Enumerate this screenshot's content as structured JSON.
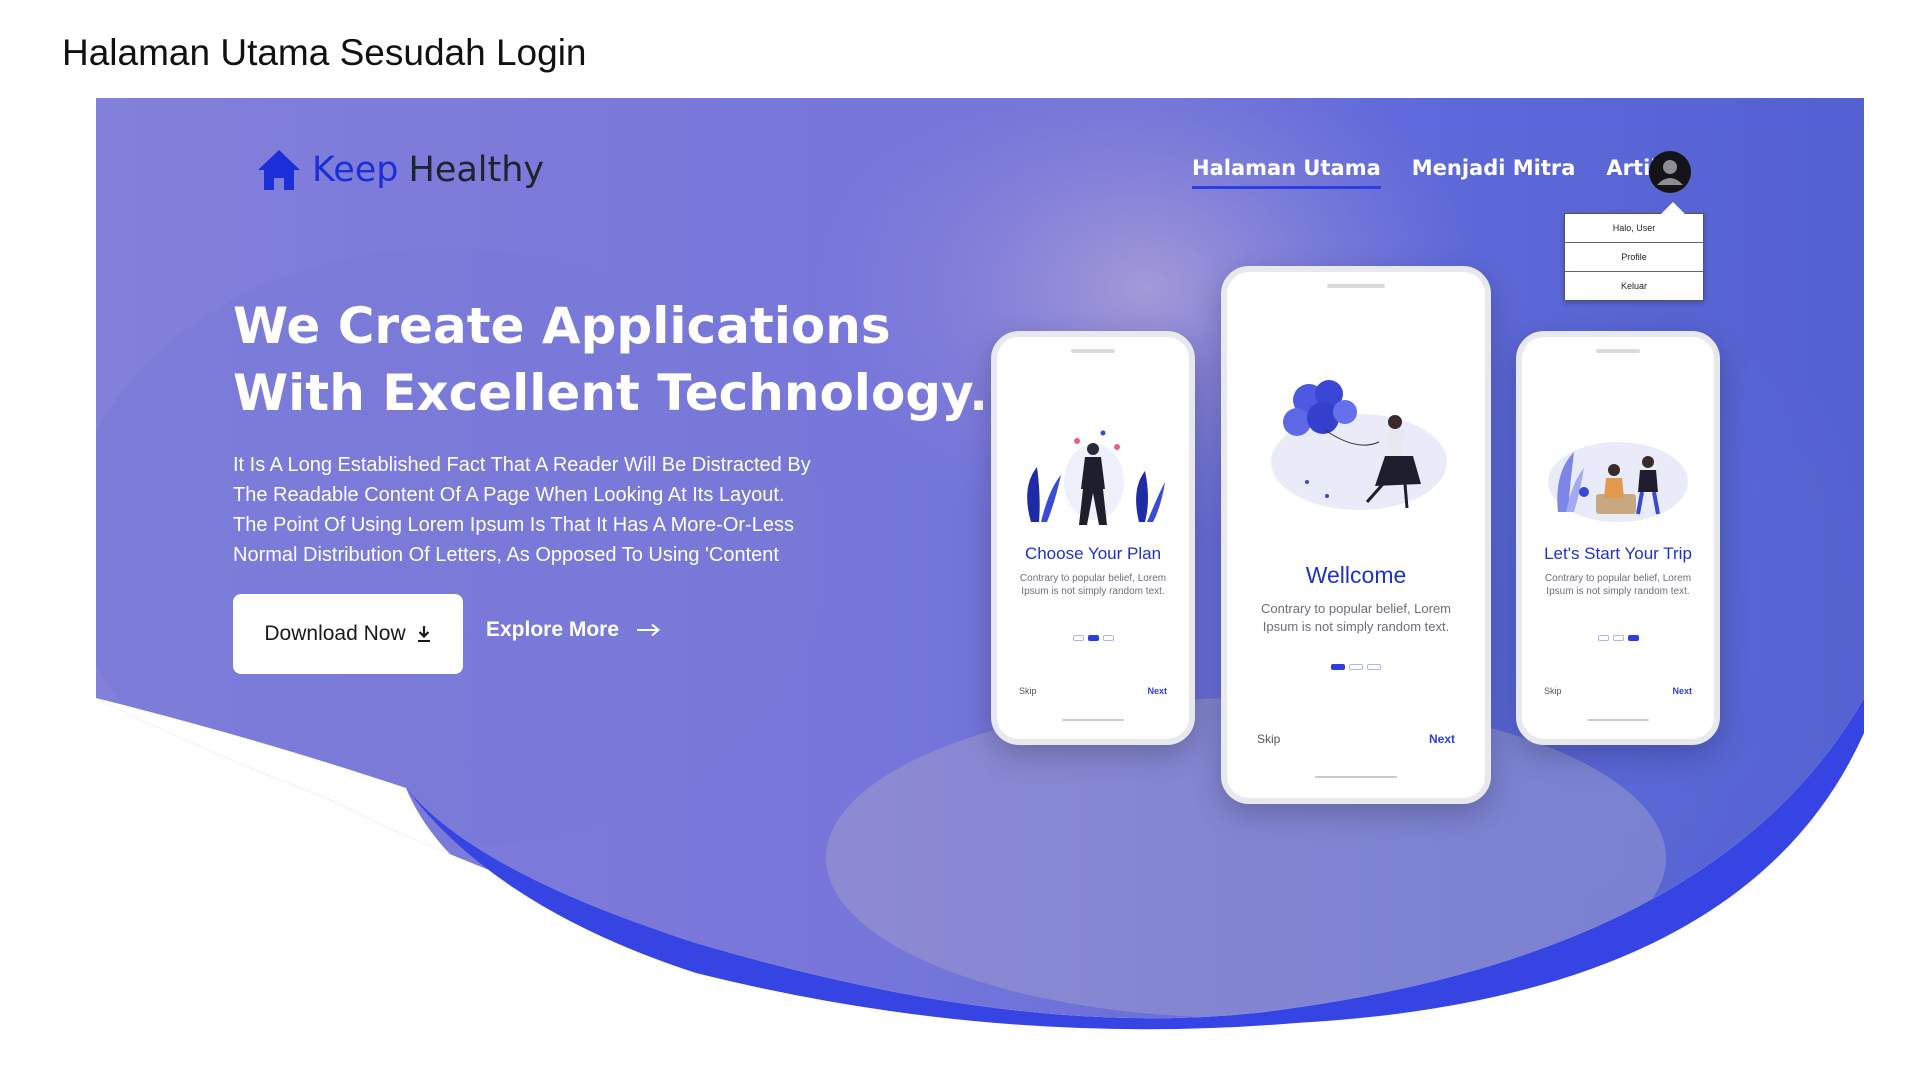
{
  "document_title": "Halaman Utama Sesudah Login",
  "brand": {
    "name_part1": "Keep",
    "name_part2": "Healthy",
    "icon": "home-icon"
  },
  "nav": {
    "items": [
      {
        "label": "Halaman Utama",
        "active": true
      },
      {
        "label": "Menjadi Mitra",
        "active": false
      },
      {
        "label": "Artikel",
        "active": false
      }
    ],
    "avatar_icon": "user-avatar-icon"
  },
  "user_menu": {
    "greeting": "Halo, User",
    "items": [
      "Profile",
      "Keluar"
    ]
  },
  "hero": {
    "heading_line1": "We Create Applications",
    "heading_line2": "With Excellent Technology.",
    "description_lines": [
      "It Is A Long Established Fact That A Reader Will Be Distracted By",
      "The Readable Content Of A Page When Looking At Its Layout.",
      "The Point Of Using Lorem Ipsum Is That It Has A More-Or-Less",
      "Normal Distribution Of Letters, As Opposed To Using 'Content"
    ],
    "download_label": "Download Now",
    "download_icon": "download-icon",
    "explore_label": "Explore More",
    "explore_icon": "arrow-right-icon"
  },
  "phones": [
    {
      "title": "Choose Your Plan",
      "text_line1": "Contrary to popular belief, Lorem",
      "text_line2": "Ipsum is not simply random text.",
      "skip": "Skip",
      "next": "Next",
      "active_dot": 2,
      "illustration": "person-with-plants-illustration"
    },
    {
      "title": "Wellcome",
      "text_line1": "Contrary to popular belief, Lorem",
      "text_line2": "Ipsum is not simply random text.",
      "skip": "Skip",
      "next": "Next",
      "active_dot": 1,
      "illustration": "woman-with-balloons-illustration"
    },
    {
      "title": "Let's Start Your Trip",
      "text_line1": "Contrary to popular belief, Lorem",
      "text_line2": "Ipsum is not simply random text.",
      "skip": "Skip",
      "next": "Next",
      "active_dot": 3,
      "illustration": "travellers-camping-illustration"
    }
  ],
  "colors": {
    "accent": "#2c3ee0",
    "overlay": "#6d6fe0",
    "wave": "#3644e3",
    "brand_blue": "#1b2fd8"
  }
}
